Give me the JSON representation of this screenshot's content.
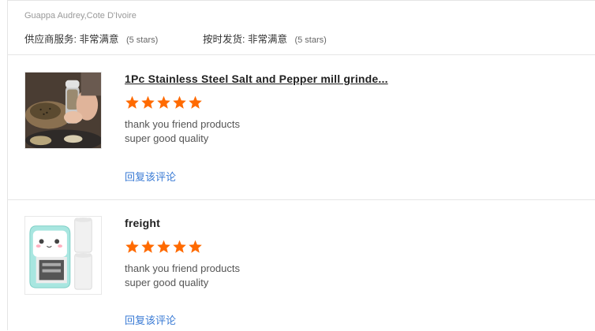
{
  "header": {
    "buyer": "Guappa Audrey,Cote D'Ivoire",
    "supplier_service": {
      "label": "供应商服务:",
      "value": "非常满意",
      "note": "(5 stars)"
    },
    "on_time_delivery": {
      "label": "按时发货:",
      "value": "非常满意",
      "note": "(5 stars)"
    }
  },
  "reviews": [
    {
      "title": "1Pc Stainless Steel Salt and Pepper mill grinde...",
      "rating": 5,
      "comment_line1": "thank you friend products",
      "comment_line2": "super good quality",
      "reply_label": "回复该评论",
      "image_icon": "pepper-grinder-photo"
    },
    {
      "title": "freight",
      "rating": 5,
      "comment_line1": "thank you friend products",
      "comment_line2": "super good quality",
      "reply_label": "回复该评论",
      "image_icon": "mini-printer-photo"
    }
  ],
  "colors": {
    "star": "#ff6a00",
    "link": "#3a7bd5",
    "divider": "#e5e5e5"
  }
}
